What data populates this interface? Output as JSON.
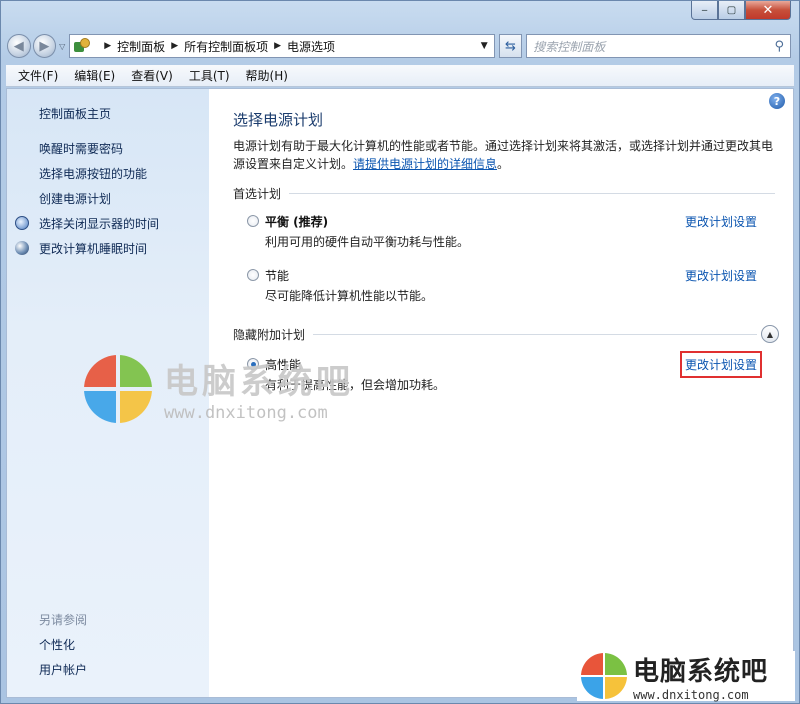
{
  "window": {
    "caption_buttons": {
      "minimize": "‒",
      "maximize": "▢",
      "close": "✕"
    }
  },
  "navbar": {
    "breadcrumbs": [
      "控制面板",
      "所有控制面板项",
      "电源选项"
    ],
    "search_placeholder": "搜索控制面板"
  },
  "menubar": [
    "文件(F)",
    "编辑(E)",
    "查看(V)",
    "工具(T)",
    "帮助(H)"
  ],
  "sidebar": {
    "home": "控制面板主页",
    "links": [
      "唤醒时需要密码",
      "选择电源按钮的功能",
      "创建电源计划",
      "选择关闭显示器的时间",
      "更改计算机睡眠时间"
    ],
    "see_also_label": "另请参阅",
    "see_also_links": [
      "个性化",
      "用户帐户"
    ]
  },
  "main": {
    "title": "选择电源计划",
    "description": "电源计划有助于最大化计算机的性能或者节能。通过选择计划来将其激活，或选择计划并通过更改其电源设置来自定义计划。",
    "description_link": "请提供电源计划的详细信息",
    "description_end": "。",
    "preferred_group": "首选计划",
    "hidden_group": "隐藏附加计划",
    "plans": [
      {
        "name": "平衡 (推荐)",
        "desc": "利用可用的硬件自动平衡功耗与性能。",
        "link": "更改计划设置",
        "checked": false
      },
      {
        "name": "节能",
        "desc": "尽可能降低计算机性能以节能。",
        "link": "更改计划设置",
        "checked": false
      },
      {
        "name": "高性能",
        "desc": "有利于提高性能，但会增加功耗。",
        "link": "更改计划设置",
        "checked": true
      }
    ]
  },
  "watermark": {
    "name": "电脑系统吧",
    "url": "www.dnxitong.com"
  }
}
